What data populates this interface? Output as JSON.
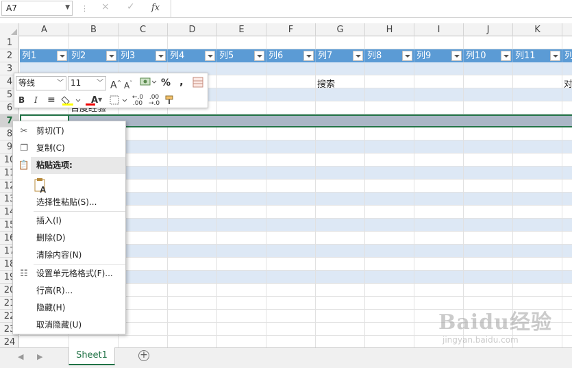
{
  "formula_bar": {
    "name_box": "A7",
    "cancel_icon": "×",
    "enter_icon": "✓",
    "fx_label": "fx"
  },
  "columns": [
    "A",
    "B",
    "C",
    "D",
    "E",
    "F",
    "G",
    "H",
    "I",
    "J",
    "K"
  ],
  "rows": [
    "1",
    "2",
    "3",
    "4",
    "5",
    "6",
    "7",
    "8",
    "9",
    "10",
    "11",
    "12",
    "13",
    "14",
    "15",
    "16",
    "17",
    "18",
    "19",
    "20",
    "21",
    "22",
    "23",
    "24"
  ],
  "selected_row": "7",
  "table_headers": [
    "列1",
    "列2",
    "列3",
    "列4",
    "列5",
    "列6",
    "列7",
    "列8",
    "列9",
    "列10",
    "列11",
    "列"
  ],
  "cells": {
    "g4": "搜索",
    "l4": "对",
    "b6": "百度经验"
  },
  "mini_toolbar": {
    "font_name": "等线",
    "font_size": "11",
    "grow_font": "A",
    "shrink_font": "A",
    "percent": "%",
    "comma": ",",
    "bold": "B",
    "italic": "I",
    "font_color_letter": "A",
    "inc_decimal": "←.0 .00",
    "dec_decimal": ".00 →.0"
  },
  "context_menu": {
    "cut": "剪切(T)",
    "copy": "复制(C)",
    "paste_options": "粘贴选项:",
    "paste_special": "选择性粘贴(S)...",
    "insert": "插入(I)",
    "delete": "删除(D)",
    "clear": "清除内容(N)",
    "format_cells": "设置单元格格式(F)...",
    "row_height": "行高(R)...",
    "hide": "隐藏(H)",
    "unhide": "取消隐藏(U)"
  },
  "sheet_tabs": [
    "Sheet1"
  ],
  "watermark": {
    "main": "Baidu经验",
    "url": "jingyan.baidu.com"
  },
  "colors": {
    "accent": "#217346",
    "table_header": "#5b9bd5",
    "band": "#dde8f5"
  }
}
